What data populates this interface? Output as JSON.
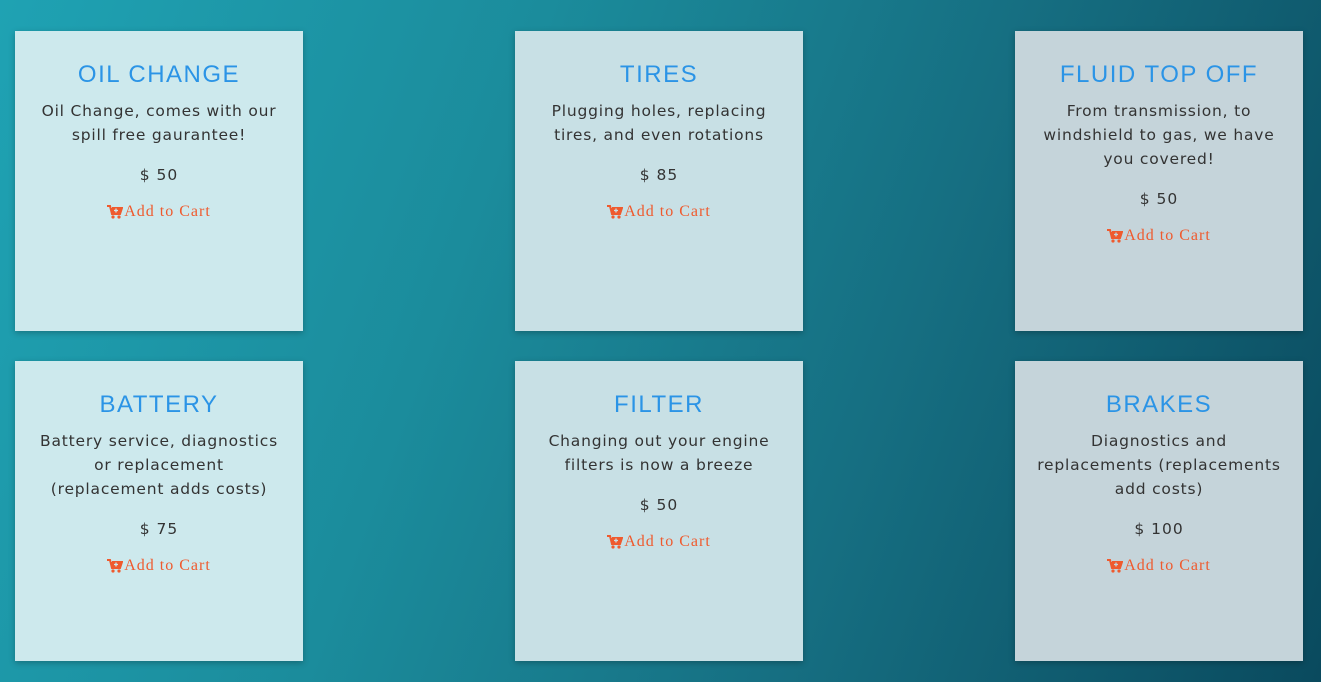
{
  "products": [
    {
      "title": "OIL CHANGE",
      "description": "Oil Change, comes with our spill free gaurantee!",
      "price": "$ 50",
      "cart_label": "Add to Cart",
      "icon": "cart-plus-icon"
    },
    {
      "title": "TIRES",
      "description": "Plugging holes, replacing tires, and even rotations",
      "price": "$ 85",
      "cart_label": "Add to Cart",
      "icon": "cart-plus-icon"
    },
    {
      "title": "FLUID TOP OFF",
      "description": "From transmission, to windshield to gas, we have you covered!",
      "price": "$ 50",
      "cart_label": "Add to Cart",
      "icon": "cart-plus-icon"
    },
    {
      "title": "BATTERY",
      "description": "Battery service, diagnostics or replacement (replacement adds costs)",
      "price": "$ 75",
      "cart_label": "Add to Cart",
      "icon": "cart-plus-icon"
    },
    {
      "title": "FILTER",
      "description": "Changing out your engine filters is now a breeze",
      "price": "$ 50",
      "cart_label": "Add to Cart",
      "icon": "cart-plus-icon"
    },
    {
      "title": "BRAKES",
      "description": "Diagnostics and replacements (replacements add costs)",
      "price": "$ 100",
      "cart_label": "Add to Cart",
      "icon": "cart-plus-icon"
    }
  ],
  "colors": {
    "title": "#2b94e6",
    "text": "#333333",
    "cart": "#ef5a2e",
    "card_bg_light": "#cde9ed",
    "card_bg_dark": "#c5d4da"
  }
}
